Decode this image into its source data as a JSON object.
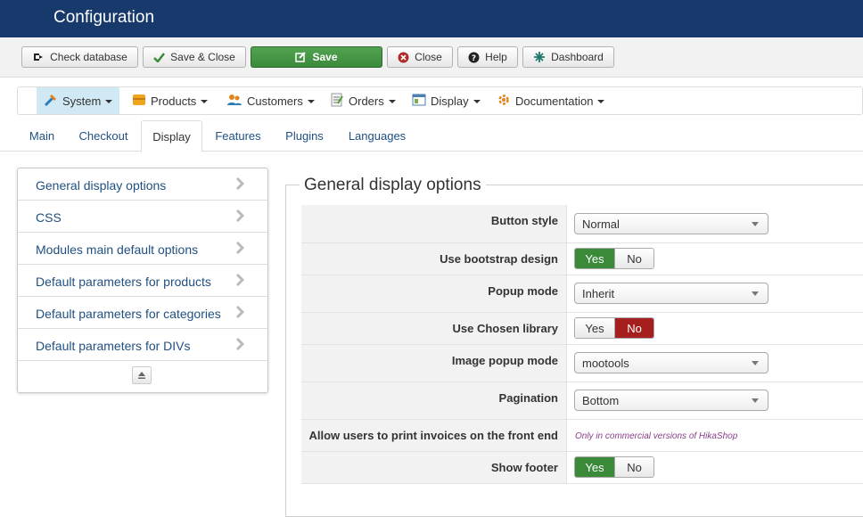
{
  "header": {
    "title": "Configuration",
    "color": "#17396b"
  },
  "toolbar": {
    "check_database": "Check database",
    "save_close": "Save & Close",
    "save": "Save",
    "close": "Close",
    "help": "Help",
    "dashboard": "Dashboard",
    "save_color": "#51a351"
  },
  "menu": {
    "system": "System",
    "products": "Products",
    "customers": "Customers",
    "orders": "Orders",
    "display": "Display",
    "documentation": "Documentation"
  },
  "tabs": {
    "main": "Main",
    "checkout": "Checkout",
    "display": "Display",
    "features": "Features",
    "plugins": "Plugins",
    "languages": "Languages"
  },
  "sidebar": {
    "items": [
      "General display options",
      "CSS",
      "Modules main default options",
      "Default parameters for products",
      "Default parameters for categories",
      "Default parameters for DIVs"
    ]
  },
  "panel": {
    "legend": "General display options",
    "rows": {
      "button_style": {
        "label": "Button style",
        "value": "Normal"
      },
      "bootstrap": {
        "label": "Use bootstrap design",
        "yes": "Yes",
        "no": "No",
        "selected": "Yes"
      },
      "popup_mode": {
        "label": "Popup mode",
        "value": "Inherit"
      },
      "chosen": {
        "label": "Use Chosen library",
        "yes": "Yes",
        "no": "No",
        "selected": "No"
      },
      "image_popup": {
        "label": "Image popup mode",
        "value": "mootools"
      },
      "pagination": {
        "label": "Pagination",
        "value": "Bottom"
      },
      "print_invoices": {
        "label": "Allow users to print invoices on the front end",
        "note": "Only in commercial versions of HikaShop"
      },
      "footer": {
        "label": "Show footer",
        "yes": "Yes",
        "no": "No",
        "selected": "Yes"
      }
    }
  },
  "colors": {
    "yes_active": "#3a8a3a",
    "no_active": "#a51f1f",
    "link": "#205081"
  }
}
